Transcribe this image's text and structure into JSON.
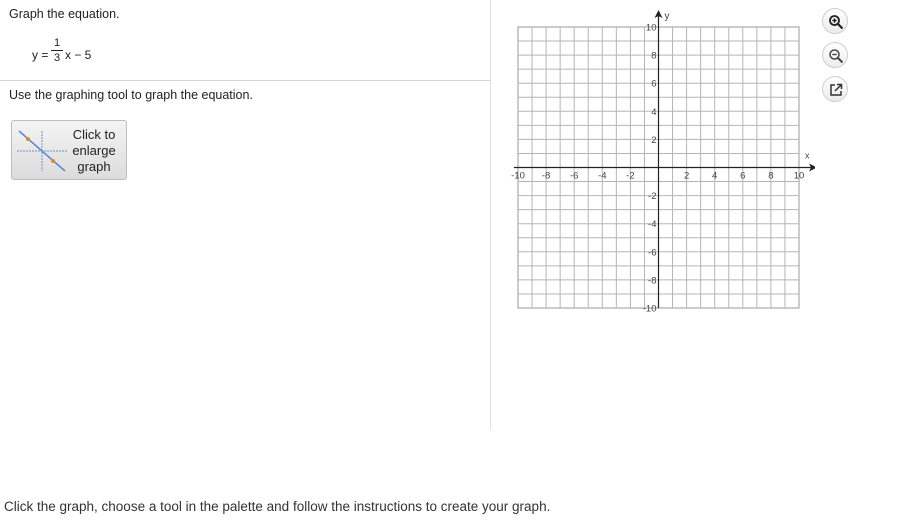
{
  "question": {
    "prompt": "Graph the equation.",
    "equation": {
      "lhs": "y =",
      "numerator": "1",
      "denominator": "3",
      "rhs": "x − 5"
    },
    "instructions": "Use the graphing tool to graph the equation."
  },
  "enlarge_button": {
    "label_line1": "Click to",
    "label_line2": "enlarge",
    "label_line3": "graph"
  },
  "graph": {
    "x_axis_label": "x",
    "y_axis_label": "y",
    "xlim": [
      -10,
      10
    ],
    "ylim": [
      -10,
      10
    ],
    "grid": true,
    "x_ticks": [
      "-10",
      "-8",
      "-6",
      "-4",
      "-2",
      "2",
      "4",
      "6",
      "8",
      "10"
    ],
    "y_ticks": [
      "10",
      "8",
      "6",
      "4",
      "2",
      "-2",
      "-4",
      "-6",
      "-8",
      "-10"
    ]
  },
  "toolbar": {
    "icons": [
      "zoom-in-icon",
      "zoom-out-icon",
      "popout-icon"
    ]
  },
  "footer": {
    "text": "Click the graph, choose a tool in the palette and follow the instructions to create your graph."
  }
}
